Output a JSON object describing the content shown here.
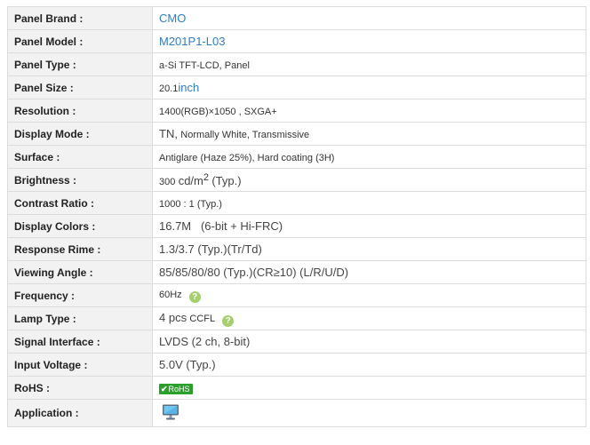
{
  "rows": [
    {
      "label": "Panel Brand :",
      "value": "CMO"
    },
    {
      "label": "Panel Model :",
      "value": "M201P1-L03"
    },
    {
      "label": "Panel Type :",
      "value": "a-Si TFT-LCD, Panel"
    },
    {
      "label": "Panel Size :",
      "value": "20.1",
      "unit": "inch"
    },
    {
      "label": "Resolution :",
      "value": "1400(RGB)×1050 , SXGA+"
    },
    {
      "label": "Display Mode :",
      "value": "TN,",
      "extra": "Normally White, Transmissive"
    },
    {
      "label": "Surface :",
      "value": "Antiglare (Haze 25%), Hard coating (3H)"
    },
    {
      "label": "Brightness :",
      "value": "300",
      "unit": "cd/m",
      "sup": "2",
      "extra": "(Typ.)"
    },
    {
      "label": "Contrast Ratio :",
      "value": "1000 : 1 (Typ.)"
    },
    {
      "label": "Display Colors :",
      "value": "16.7M   (6-bit + Hi-FRC)"
    },
    {
      "label": "Response Rime :",
      "value": "1.3/3.7 (Typ.)(Tr/Td)"
    },
    {
      "label": "Viewing Angle :",
      "value": "85/85/80/80 (Typ.)(CR≥10) (L/R/U/D)"
    },
    {
      "label": "Frequency :",
      "value": "60Hz"
    },
    {
      "label": "Lamp Type :",
      "value": "4 pcs",
      "extra": "CCFL"
    },
    {
      "label": "Signal Interface :",
      "value": "LVDS (2 ch, 8-bit)"
    },
    {
      "label": "Input Voltage :",
      "value": "5.0V (Typ.)"
    },
    {
      "label": "RoHS :",
      "badge": "RoHS"
    },
    {
      "label": "Application :",
      "icon": "monitor-icon"
    }
  ],
  "icons": {
    "help": "question-mark-icon",
    "help_glyph": "?",
    "check_glyph": "✔"
  },
  "colors": {
    "link": "#2f7dc3",
    "label_bg": "#f2f2f2",
    "border": "#dcdcdc",
    "rohs": "#2aa02a",
    "help": "#a5cf6b"
  }
}
